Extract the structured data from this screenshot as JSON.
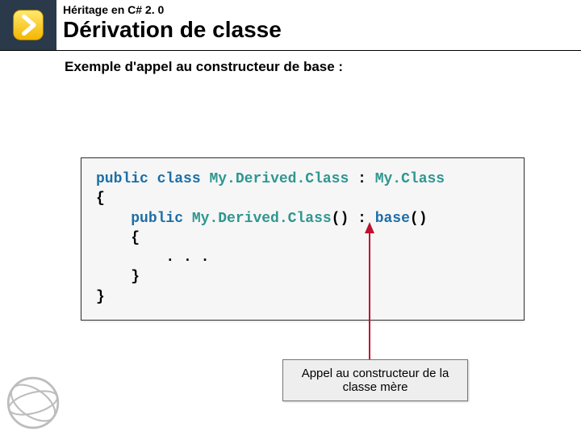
{
  "header": {
    "breadcrumb": "Héritage en C# 2. 0",
    "title": "Dérivation de classe"
  },
  "subtitle": "Exemple d'appel au constructeur de base :",
  "code": {
    "kw_public1": "public",
    "kw_class": "class",
    "type_derived": "My.Derived.Class",
    "colon1": " : ",
    "type_base": "My.Class",
    "brace_open1": "{",
    "indent_public": "    ",
    "kw_public2": "public",
    "space1": " ",
    "type_derived_ctor": "My.Derived.Class",
    "parens1": "()",
    "colon2": " : ",
    "kw_base": "base",
    "parens2": "()",
    "brace_open2": "    {",
    "dots": "        . . .",
    "brace_close2": "    }",
    "brace_close1": "}"
  },
  "callout": "Appel au constructeur de la classe mère"
}
